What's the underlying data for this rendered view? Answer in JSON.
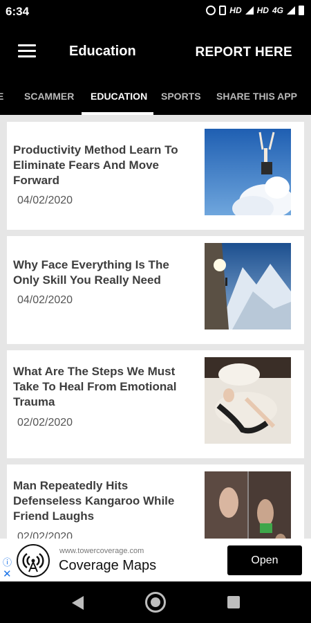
{
  "status_bar": {
    "time": "6:34",
    "network": "HD",
    "network2": "HD",
    "network_type": "4G"
  },
  "toolbar": {
    "title": "Education",
    "report_label": "REPORT HERE"
  },
  "tabs": [
    {
      "label": "E"
    },
    {
      "label": "SCAMMER"
    },
    {
      "label": "EDUCATION",
      "active": true
    },
    {
      "label": "SPORTS"
    },
    {
      "label": "SHARE THIS APP"
    }
  ],
  "articles": [
    {
      "title": "Productivity Method Learn To Eliminate Fears And Move Forward",
      "date": "04/02/2020",
      "thumb_icon": "sky-jump-image"
    },
    {
      "title": "Why Face Everything Is The Only Skill You Really Need",
      "date": "04/02/2020",
      "thumb_icon": "mountain-climber-image"
    },
    {
      "title": "What Are The Steps We Must Take To Heal From Emotional Trauma",
      "date": "02/02/2020",
      "thumb_icon": "woman-on-bed-image"
    },
    {
      "title": "Man Repeatedly Hits Defenseless Kangaroo While Friend Laughs",
      "date": "02/02/2020",
      "thumb_icon": "kangaroo-video-image"
    }
  ],
  "ad": {
    "url": "www.towercoverage.com",
    "title": "Coverage Maps",
    "open_label": "Open",
    "close_glyph": "✕",
    "info_glyph": "ⓘ"
  },
  "colors": {
    "header_bg": "#000000",
    "list_bg": "#e6e6e6",
    "card_title": "#3d3d3d",
    "ad_accent": "#1a73e8"
  }
}
